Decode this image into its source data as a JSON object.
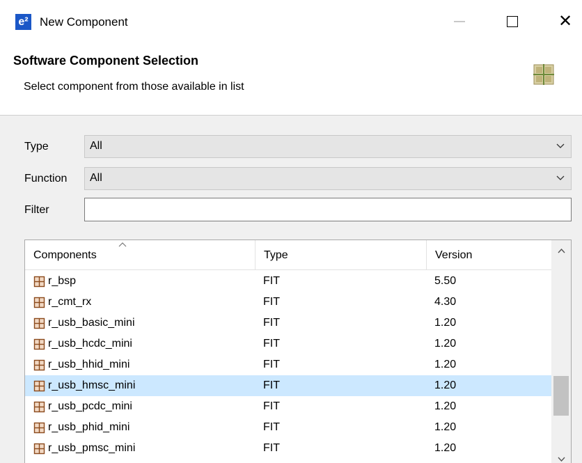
{
  "window": {
    "app_icon": "e²",
    "title": "New Component",
    "controls": [
      "minimize-icon",
      "maximize-icon",
      "close-icon"
    ],
    "close_glyph": "✕"
  },
  "banner": {
    "title": "Software Component Selection",
    "subtitle": "Select component from those available in list",
    "icon": "component-grid-icon"
  },
  "form": {
    "type_label": "Type",
    "type_value": "All",
    "function_label": "Function",
    "function_value": "All",
    "filter_label": "Filter",
    "filter_value": ""
  },
  "table": {
    "columns": [
      "Components",
      "Type",
      "Version"
    ],
    "sorted_column": "Components",
    "rows": [
      {
        "name": "r_bsp",
        "type": "FIT",
        "version": "5.50",
        "selected": false
      },
      {
        "name": "r_cmt_rx",
        "type": "FIT",
        "version": "4.30",
        "selected": false
      },
      {
        "name": "r_usb_basic_mini",
        "type": "FIT",
        "version": "1.20",
        "selected": false
      },
      {
        "name": "r_usb_hcdc_mini",
        "type": "FIT",
        "version": "1.20",
        "selected": false
      },
      {
        "name": "r_usb_hhid_mini",
        "type": "FIT",
        "version": "1.20",
        "selected": false
      },
      {
        "name": "r_usb_hmsc_mini",
        "type": "FIT",
        "version": "1.20",
        "selected": true
      },
      {
        "name": "r_usb_pcdc_mini",
        "type": "FIT",
        "version": "1.20",
        "selected": false
      },
      {
        "name": "r_usb_phid_mini",
        "type": "FIT",
        "version": "1.20",
        "selected": false
      },
      {
        "name": "r_usb_pmsc_mini",
        "type": "FIT",
        "version": "1.20",
        "selected": false
      }
    ]
  },
  "colors": {
    "selection": "#cce8ff",
    "app_icon_bg": "#1b57c7",
    "component_icon": "#8b4a1c"
  }
}
